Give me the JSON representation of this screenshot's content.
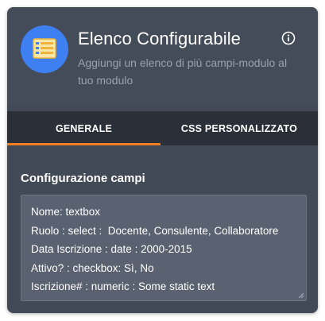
{
  "header": {
    "title": "Elenco Configurabile",
    "description": "Aggiungi un elenco di più campi-modulo al tuo modulo",
    "icon": "list-form-icon",
    "info_icon": "info-icon"
  },
  "tabs": [
    {
      "label": "GENERALE",
      "active": true
    },
    {
      "label": "CSS PERSONALIZZATO",
      "active": false
    }
  ],
  "config": {
    "label": "Configurazione campi",
    "lines": [
      "Nome: textbox",
      "Ruolo : select :  Docente, Consulente, Collaboratore",
      "Data Iscrizione : date : 2000-2015",
      "Attivo? : checkbox: Sì, No",
      "Iscrizione# : numeric : Some static text"
    ]
  },
  "colors": {
    "panel": "#434a57",
    "tab_bar": "#2b3038",
    "accent": "#f07d1e",
    "icon_bg": "#3e7ff1",
    "textarea_bg": "#5a6170"
  }
}
